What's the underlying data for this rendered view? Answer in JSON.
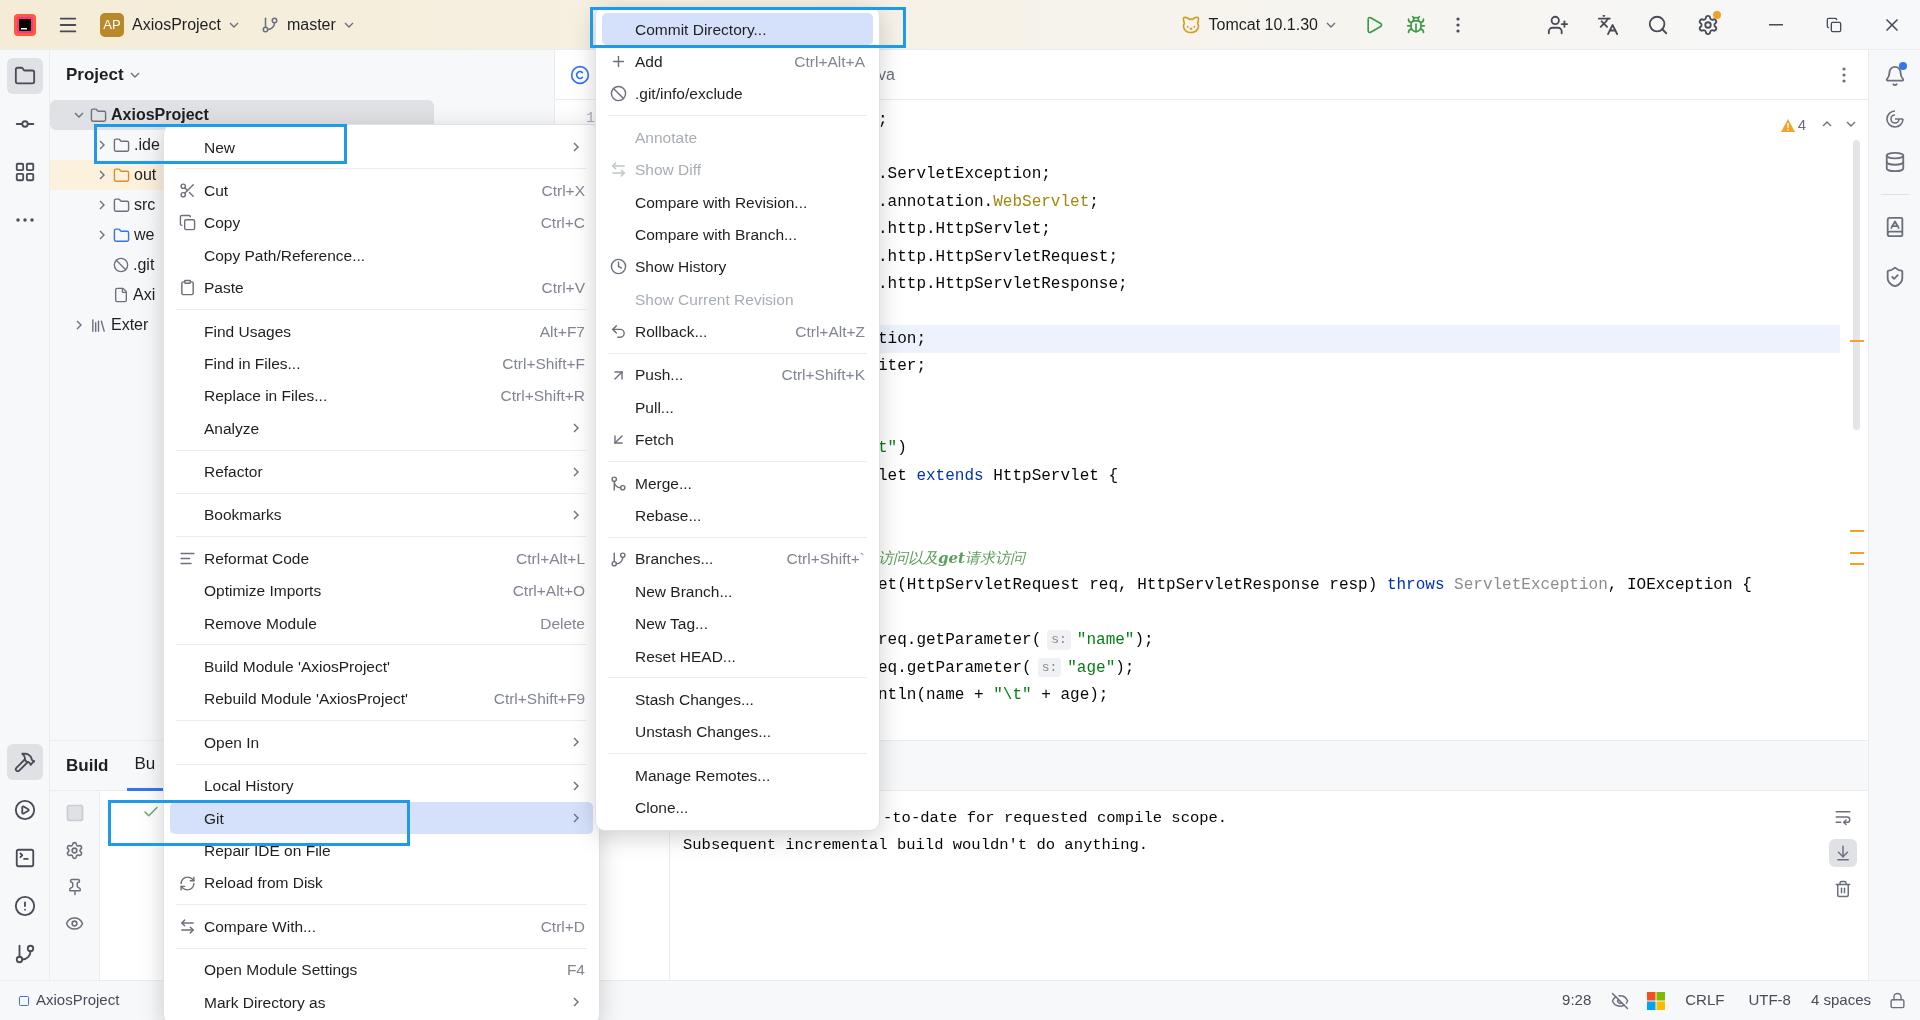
{
  "title_bar": {
    "app_badge": "AP",
    "project": "AxiosProject",
    "branch": "master",
    "run_config": "Tomcat 10.1.30",
    "settings_update": true,
    "notifications_unread": true
  },
  "left_tools_top": [
    {
      "selected": true
    },
    {
      "selected": false
    },
    {
      "selected": false
    },
    {
      "selected": false
    }
  ],
  "left_tools_bottom": [
    {
      "selected": true
    },
    {
      "selected": false
    },
    {
      "selected": false
    },
    {
      "selected": false
    },
    {
      "selected": false
    }
  ],
  "project_panel": {
    "title": "Project",
    "tree": [
      {
        "label": "AxiosProject",
        "kind": "module",
        "expanded": true,
        "selected": true,
        "children": [
          {
            "label": ".ide",
            "kind": "folder",
            "expanded": false,
            "selected": false
          },
          {
            "label": "out",
            "kind": "excluded",
            "expanded": false,
            "selected": false
          },
          {
            "label": "src",
            "kind": "folder",
            "expanded": false,
            "selected": false
          },
          {
            "label": "we",
            "kind": "web",
            "expanded": false,
            "selected": false
          },
          {
            "label": ".git",
            "kind": "ignored",
            "selected": false
          },
          {
            "label": "Axi",
            "kind": "file",
            "selected": false
          }
        ]
      },
      {
        "label": "Exter",
        "kind": "library",
        "expanded": false,
        "selected": false
      }
    ]
  },
  "editor": {
    "tab": {
      "label": "va"
    },
    "warnings": "4",
    "lines": [
      {
        "number": "1",
        "current": false,
        "segments": [
          {
            "kind": "plain",
            "text": ";"
          }
        ]
      },
      {
        "current": false
      },
      {
        "current": false,
        "segments": [
          {
            "kind": "plain",
            "text": ".ServletException;"
          }
        ]
      },
      {
        "current": false,
        "segments": [
          {
            "kind": "plain",
            "text": ".annotation."
          },
          {
            "kind": "annotation",
            "text": "WebServlet"
          },
          {
            "kind": "plain",
            "text": ";"
          }
        ]
      },
      {
        "current": false,
        "segments": [
          {
            "kind": "plain",
            "text": ".http.HttpServlet;"
          }
        ]
      },
      {
        "current": false,
        "segments": [
          {
            "kind": "plain",
            "text": ".http.HttpServletRequest;"
          }
        ]
      },
      {
        "current": false,
        "segments": [
          {
            "kind": "plain",
            "text": ".http.HttpServletResponse;"
          }
        ]
      },
      {
        "current": false
      },
      {
        "current": true,
        "segments": [
          {
            "kind": "plain",
            "text": "tion;"
          }
        ]
      },
      {
        "current": false,
        "segments": [
          {
            "kind": "plain",
            "text": "iter;"
          }
        ]
      },
      {
        "current": false
      },
      {
        "current": false
      },
      {
        "current": false,
        "segments": [
          {
            "kind": "string",
            "text": "t\""
          },
          {
            "kind": "plain",
            "text": ")"
          }
        ]
      },
      {
        "current": false,
        "segments": [
          {
            "kind": "plain",
            "text": "let "
          },
          {
            "kind": "keyword",
            "text": "extends"
          },
          {
            "kind": "plain",
            "text": " HttpServlet {"
          }
        ]
      },
      {
        "current": false
      },
      {
        "current": false
      },
      {
        "current": false,
        "segments": [
          {
            "kind": "comment",
            "text": "访问以及**get**请求访问"
          }
        ]
      },
      {
        "current": false,
        "segments": [
          {
            "kind": "plain",
            "text": "et(HttpServletRequest req, HttpServletResponse resp) "
          },
          {
            "kind": "keyword",
            "text": "throws"
          },
          {
            "kind": "muted",
            "text": " ServletException"
          },
          {
            "kind": "plain",
            "text": ", IOException {"
          }
        ]
      },
      {
        "current": false
      },
      {
        "current": false,
        "segments": [
          {
            "kind": "plain",
            "text": "req.getParameter("
          },
          {
            "kind": "hint",
            "text": "s:"
          },
          {
            "kind": "string",
            "text": "\"name\""
          },
          {
            "kind": "plain",
            "text": ");"
          }
        ]
      },
      {
        "current": false,
        "segments": [
          {
            "kind": "plain",
            "text": "eq.getParameter("
          },
          {
            "kind": "hint",
            "text": "s:"
          },
          {
            "kind": "string",
            "text": "\"age\""
          },
          {
            "kind": "plain",
            "text": ");"
          }
        ]
      },
      {
        "current": false,
        "segments": [
          {
            "kind": "plain",
            "text": "ntln(name + "
          },
          {
            "kind": "string",
            "text": "\"\\t\""
          },
          {
            "kind": "plain",
            "text": " + age);"
          }
        ]
      }
    ]
  },
  "build_panel": {
    "title": "Build",
    "tabs": [
      {
        "label": "Bu",
        "selected": true
      }
    ],
    "console": [
      {
        "kind": "partial",
        "text": "-to-date for requested compile scope."
      },
      {
        "kind": "full",
        "text": "Subsequent incremental build wouldn't do anything."
      }
    ],
    "tools": [
      {
        "selected": false
      },
      {
        "selected": true
      },
      {
        "selected": false
      }
    ]
  },
  "status_bar": {
    "project": "AxiosProject",
    "position": "9:28",
    "line_separator": "CRLF",
    "encoding": "UTF-8",
    "indent": "4 spaces"
  },
  "context_menu": {
    "groups": [
      [
        {
          "label": "New",
          "submenu": true,
          "selected": false
        }
      ],
      [
        {
          "label": "Cut",
          "shortcut": "Ctrl+X",
          "selected": false
        },
        {
          "label": "Copy",
          "shortcut": "Ctrl+C",
          "selected": false
        },
        {
          "label": "Copy Path/Reference...",
          "selected": false
        },
        {
          "label": "Paste",
          "shortcut": "Ctrl+V",
          "selected": false
        }
      ],
      [
        {
          "label": "Find Usages",
          "shortcut": "Alt+F7",
          "selected": false
        },
        {
          "label": "Find in Files...",
          "shortcut": "Ctrl+Shift+F",
          "selected": false
        },
        {
          "label": "Replace in Files...",
          "shortcut": "Ctrl+Shift+R",
          "selected": false
        },
        {
          "label": "Analyze",
          "submenu": true,
          "selected": false
        }
      ],
      [
        {
          "label": "Refactor",
          "submenu": true,
          "selected": false
        }
      ],
      [
        {
          "label": "Bookmarks",
          "submenu": true,
          "selected": false
        }
      ],
      [
        {
          "label": "Reformat Code",
          "shortcut": "Ctrl+Alt+L",
          "selected": false
        },
        {
          "label": "Optimize Imports",
          "shortcut": "Ctrl+Alt+O",
          "selected": false
        },
        {
          "label": "Remove Module",
          "shortcut": "Delete",
          "selected": false
        }
      ],
      [
        {
          "label": "Build Module 'AxiosProject'",
          "selected": false
        },
        {
          "label": "Rebuild Module 'AxiosProject'",
          "shortcut": "Ctrl+Shift+F9",
          "selected": false
        }
      ],
      [
        {
          "label": "Open In",
          "submenu": true,
          "selected": false
        }
      ],
      [
        {
          "label": "Local History",
          "submenu": true,
          "selected": false
        },
        {
          "label": "Git",
          "submenu": true,
          "selected": true
        },
        {
          "label": "Repair IDE on File",
          "selected": false
        },
        {
          "label": "Reload from Disk",
          "selected": false
        }
      ],
      [
        {
          "label": "Compare With...",
          "shortcut": "Ctrl+D",
          "selected": false
        }
      ],
      [
        {
          "label": "Open Module Settings",
          "shortcut": "F4",
          "selected": false
        },
        {
          "label": "Mark Directory as",
          "submenu": true,
          "selected": false
        }
      ]
    ]
  },
  "git_menu": {
    "groups": [
      [
        {
          "label": "Commit Directory...",
          "selected": true,
          "disabled": false
        },
        {
          "label": "Add",
          "shortcut": "Ctrl+Alt+A",
          "selected": false,
          "disabled": false
        },
        {
          "label": ".git/info/exclude",
          "selected": false,
          "disabled": false
        }
      ],
      [
        {
          "label": "Annotate",
          "selected": false,
          "disabled": true
        },
        {
          "label": "Show Diff",
          "selected": false,
          "disabled": true
        },
        {
          "label": "Compare with Revision...",
          "selected": false,
          "disabled": false
        },
        {
          "label": "Compare with Branch...",
          "selected": false,
          "disabled": false
        },
        {
          "label": "Show History",
          "selected": false,
          "disabled": false
        },
        {
          "label": "Show Current Revision",
          "selected": false,
          "disabled": true
        },
        {
          "label": "Rollback...",
          "shortcut": "Ctrl+Alt+Z",
          "selected": false,
          "disabled": false
        }
      ],
      [
        {
          "label": "Push...",
          "shortcut": "Ctrl+Shift+K",
          "selected": false,
          "disabled": false
        },
        {
          "label": "Pull...",
          "selected": false,
          "disabled": false
        },
        {
          "label": "Fetch",
          "selected": false,
          "disabled": false
        }
      ],
      [
        {
          "label": "Merge...",
          "selected": false,
          "disabled": false
        },
        {
          "label": "Rebase...",
          "selected": false,
          "disabled": false
        }
      ],
      [
        {
          "label": "Branches...",
          "shortcut": "Ctrl+Shift+`",
          "selected": false,
          "disabled": false
        },
        {
          "label": "New Branch...",
          "selected": false,
          "disabled": false
        },
        {
          "label": "New Tag...",
          "selected": false,
          "disabled": false
        },
        {
          "label": "Reset HEAD...",
          "selected": false,
          "disabled": false
        }
      ],
      [
        {
          "label": "Stash Changes...",
          "selected": false,
          "disabled": false
        },
        {
          "label": "Unstash Changes...",
          "selected": false,
          "disabled": false
        }
      ],
      [
        {
          "label": "Manage Remotes...",
          "selected": false,
          "disabled": false
        },
        {
          "label": "Clone...",
          "selected": false,
          "disabled": false
        }
      ]
    ]
  }
}
